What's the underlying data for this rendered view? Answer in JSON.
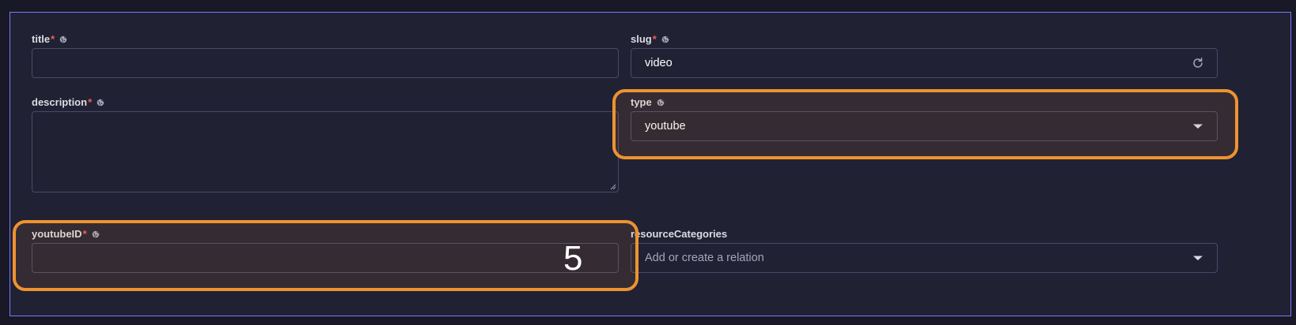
{
  "fields": {
    "title": {
      "label": "title",
      "required_mark": "*",
      "value": ""
    },
    "slug": {
      "label": "slug",
      "required_mark": "*",
      "value": "video",
      "action_icon": "refresh-icon"
    },
    "description": {
      "label": "description",
      "required_mark": "*",
      "value": ""
    },
    "type": {
      "label": "type",
      "value": "youtube",
      "action_icon": "caret-down-icon"
    },
    "youtube_id": {
      "label": "youtubeID",
      "required_mark": "*",
      "value": ""
    },
    "resource_categories": {
      "label": "resourceCategories",
      "placeholder": "Add or create a relation",
      "action_icon": "caret-down-icon"
    }
  },
  "annotation": {
    "marker": "5"
  },
  "colors": {
    "background": "#181826",
    "panel": "#212134",
    "border": "#4a4a6a",
    "focus_outline": "#7b79ff",
    "highlight": "#ee9330",
    "required": "#ee5e52"
  },
  "icons": [
    "globe-icon",
    "refresh-icon",
    "caret-down-icon"
  ]
}
